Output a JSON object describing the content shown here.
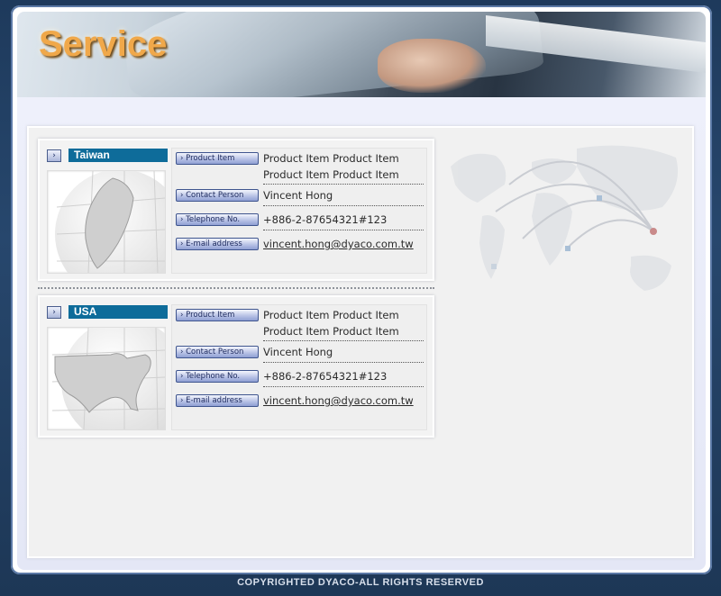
{
  "banner": {
    "title": "Service"
  },
  "footer": {
    "copyright": "COPYRIGHTED DYACO-ALL RIGHTS RESERVED"
  },
  "field_labels": {
    "product": "Product Item",
    "contact": "Contact Person",
    "telephone": "Telephone No.",
    "email": "E-mail address"
  },
  "regions": [
    {
      "name": "Taiwan",
      "product_line1": "Product Item Product Item",
      "product_line2": "Product Item Product Item",
      "contact": "Vincent Hong",
      "telephone": "+886-2-87654321#123",
      "email": "vincent.hong@dyaco.com.tw"
    },
    {
      "name": "USA",
      "product_line1": "Product Item Product Item",
      "product_line2": "Product Item Product Item",
      "contact": "Vincent Hong",
      "telephone": "+886-2-87654321#123",
      "email": "vincent.hong@dyaco.com.tw"
    }
  ],
  "icons": {
    "region_arrow": "chevron-right-icon",
    "label_arrow": "chevron-right-icon"
  },
  "colors": {
    "title": "#f0a84a",
    "region_label_bg": "#0e6c9a",
    "page_bg": "#1e3a5c"
  }
}
